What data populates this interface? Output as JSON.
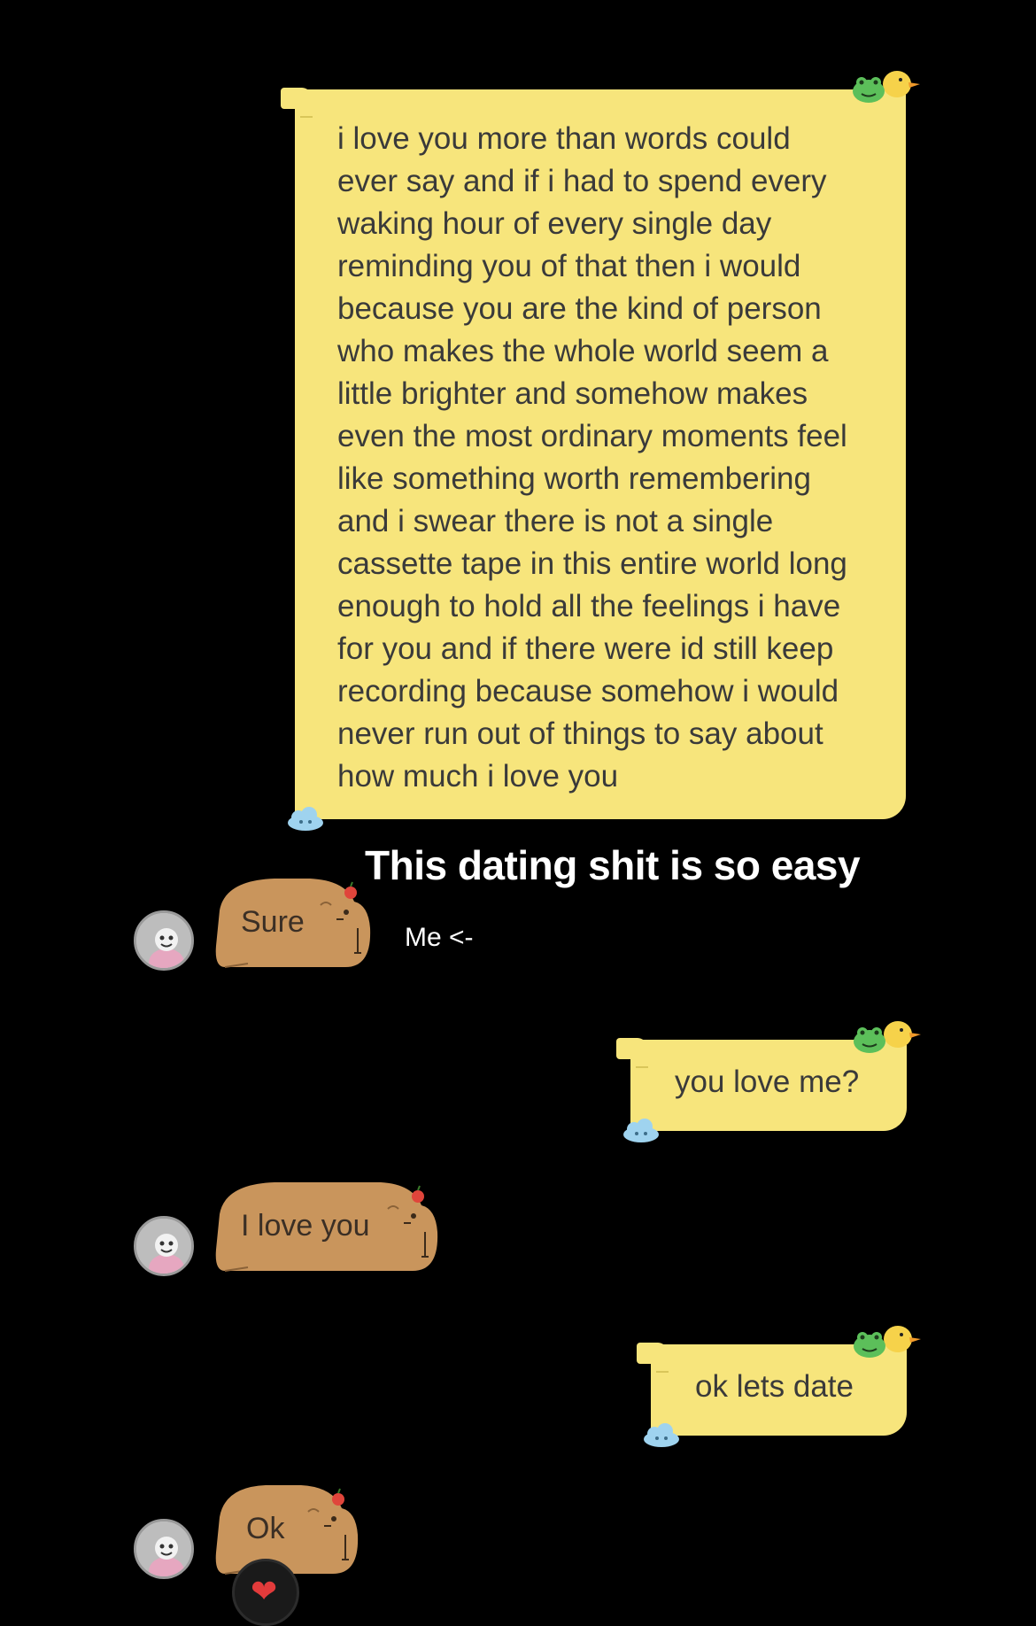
{
  "messages": {
    "outgoing_long": "i love you more than words could\never say and if i had to spend every\nwaking hour of every single day\nreminding you of that then i would\nbecause you are the kind of person\nwho makes the whole world seem a\nlittle brighter and somehow makes\neven the most ordinary moments feel\nlike something worth remembering\nand i swear there is not a single\ncassette tape in this entire world long\nenough to hold all the feelings i have\nfor you and if there were id still keep\nrecording because somehow i would\nnever run out of things to say about\nhow much i love you",
    "incoming_sure": "Sure",
    "outgoing_you_love_me": "you love me?",
    "incoming_i_love_you": "I love you",
    "outgoing_ok_lets_date": "ok lets date",
    "incoming_ok": "Ok"
  },
  "overlay": {
    "caption_main": "This dating shit is so easy",
    "caption_sub": "Me <-"
  },
  "reaction": {
    "icon": "heart-icon",
    "glyph": "❤"
  },
  "colors": {
    "background": "#000000",
    "outgoing_bubble": "#f7e57c",
    "incoming_bubble": "#c9955c",
    "caption_text": "#ffffff",
    "heart": "#e23b3b"
  }
}
